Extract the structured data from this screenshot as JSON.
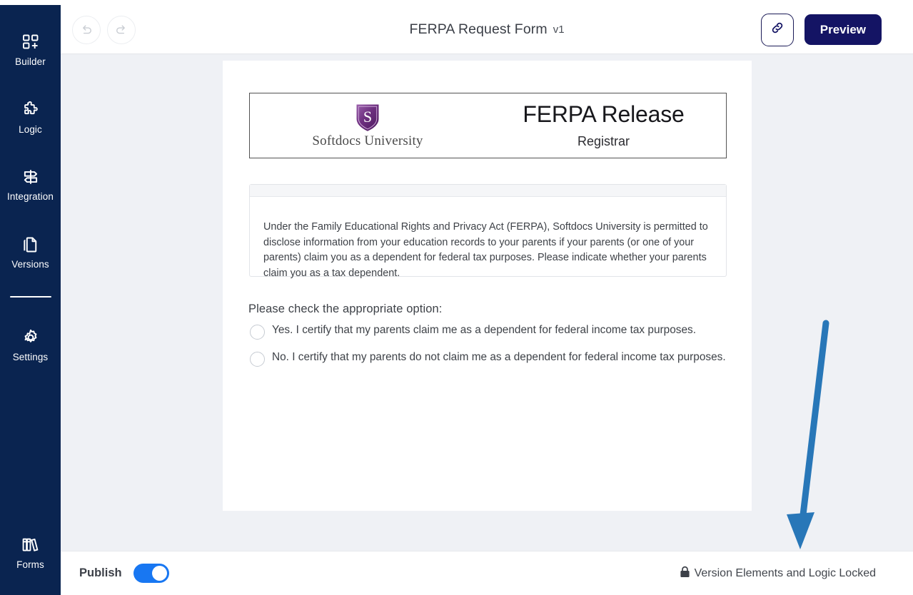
{
  "sidebar": {
    "items": [
      {
        "label": "Builder",
        "icon": "builder-grid-plus-icon"
      },
      {
        "label": "Logic",
        "icon": "puzzle-piece-icon"
      },
      {
        "label": "Integration",
        "icon": "signpost-icon"
      },
      {
        "label": "Versions",
        "icon": "documents-copy-icon"
      },
      {
        "label": "Settings",
        "icon": "gear-icon"
      }
    ],
    "bottom_item": {
      "label": "Forms",
      "icon": "books-icon"
    },
    "background_color": "#0a2450"
  },
  "topbar": {
    "undo_icon": "undo-arrow-icon",
    "redo_icon": "redo-arrow-icon",
    "title": "FERPA Request Form",
    "version": "v1",
    "link_icon": "link-chain-icon",
    "preview_label": "Preview",
    "preview_color": "#141464"
  },
  "form": {
    "header": {
      "logo_icon": "softdocs-shield-logo",
      "university": "Softdocs University",
      "title": "FERPA Release",
      "subtitle": "Registrar"
    },
    "text_block": "Under the Family Educational Rights and Privacy Act (FERPA), Softdocs University is permitted to disclose information from your education records to your parents if your parents (or one of your parents) claim you as a dependent for federal tax purposes. Please indicate whether your parents claim you as a tax dependent.",
    "radio_group": {
      "label": "Please check the appropriate option:",
      "options": [
        {
          "text": "Yes. I certify that my parents claim me as a dependent for federal income tax purposes.",
          "selected": false
        },
        {
          "text": "No. I certify that my parents do not claim me as a dependent for federal income tax purposes.",
          "selected": false
        }
      ]
    }
  },
  "bottombar": {
    "publish_label": "Publish",
    "publish_on": true,
    "toggle_color": "#1877f2",
    "lock_icon": "lock-closed-icon",
    "lock_text": "Version Elements and Logic Locked"
  },
  "annotation": {
    "arrow_color": "#2877b8",
    "arrow_direction": "down"
  }
}
